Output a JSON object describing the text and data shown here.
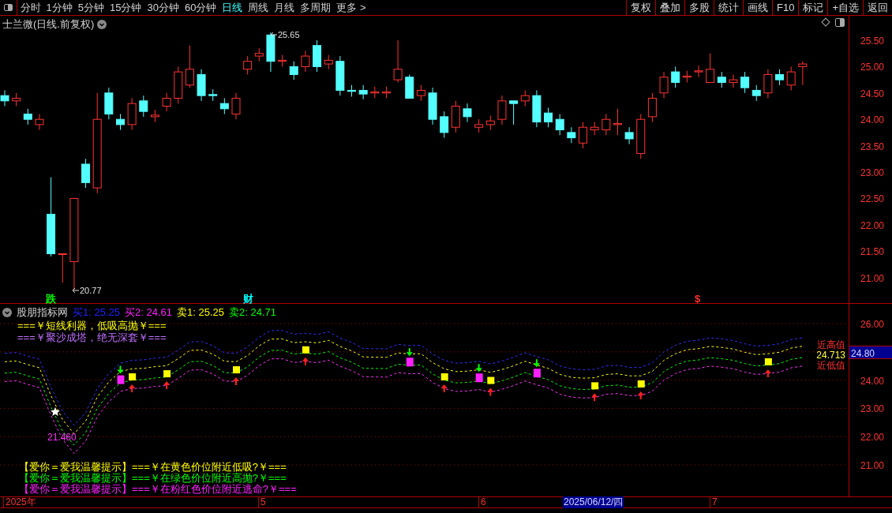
{
  "toolbar": {
    "periods": [
      {
        "label": "分时",
        "selected": false
      },
      {
        "label": "1分钟",
        "selected": false
      },
      {
        "label": "5分钟",
        "selected": false
      },
      {
        "label": "15分钟",
        "selected": false
      },
      {
        "label": "30分钟",
        "selected": false
      },
      {
        "label": "60分钟",
        "selected": false
      },
      {
        "label": "日线",
        "selected": true
      },
      {
        "label": "周线",
        "selected": false
      },
      {
        "label": "月线",
        "selected": false
      },
      {
        "label": "多周期",
        "selected": false
      },
      {
        "label": "更多 >",
        "selected": false
      }
    ],
    "actions": [
      "复权",
      "叠加",
      "多股",
      "统计",
      "画线",
      "F10",
      "标记",
      "+自选",
      "返回"
    ]
  },
  "main_chart": {
    "title": "士兰微(日线.前复权)",
    "price_labels": [
      {
        "kind": "high",
        "label": "25.65"
      },
      {
        "kind": "low",
        "label": "20.77"
      }
    ],
    "event_marks": [
      {
        "label": "跌",
        "color": "#00ff00"
      },
      {
        "label": "财",
        "color": "#00ffff"
      },
      {
        "label": "$",
        "color": "#ff3030"
      }
    ],
    "y_axis": [
      "25.50",
      "25.00",
      "24.50",
      "24.00",
      "23.50",
      "23.00",
      "22.50",
      "22.00",
      "21.50",
      "21.00"
    ]
  },
  "indicator": {
    "name": "股朋指标网",
    "readouts": [
      {
        "label": "买1: 25.25",
        "color": "#2020ff"
      },
      {
        "label": "买2: 24.61",
        "color": "#ff20ff"
      },
      {
        "label": "卖1: 25.25",
        "color": "#ffff00"
      },
      {
        "label": "卖2: 24.71",
        "color": "#00ff00"
      }
    ],
    "banner_lines": [
      {
        "text": "===￥短线利器，低吸高抛￥===",
        "color": "#ffff00"
      },
      {
        "text": "===￥聚沙成塔，绝无深套￥===",
        "color": "#c070ff"
      }
    ],
    "tips": [
      {
        "text": "【爱你＝爱我温馨提示】===￥在黄色价位附近低吸?￥===",
        "color": "#ffff00"
      },
      {
        "text": "【爱你＝爱我温馨提示】===￥在绿色价位附近高抛?￥===",
        "color": "#00ff00"
      },
      {
        "text": "【爱你＝爱我温馨提示】===￥在粉红色价位附近逃命?￥===",
        "color": "#ff20ff"
      }
    ],
    "low_value": "21.460",
    "end_labels": [
      {
        "kind": "high",
        "label": "近高值"
      },
      {
        "kind": "value",
        "label": "24.713"
      },
      {
        "kind": "low",
        "label": "近低值"
      }
    ],
    "y_axis": [
      "26.00",
      "24.00",
      "23.00",
      "22.00",
      "21.00"
    ],
    "current_price": "24.80"
  },
  "time_axis": {
    "labels": [
      "2025年",
      "5",
      "6",
      "7"
    ],
    "cursor_date": "2025/06/12/四"
  }
}
